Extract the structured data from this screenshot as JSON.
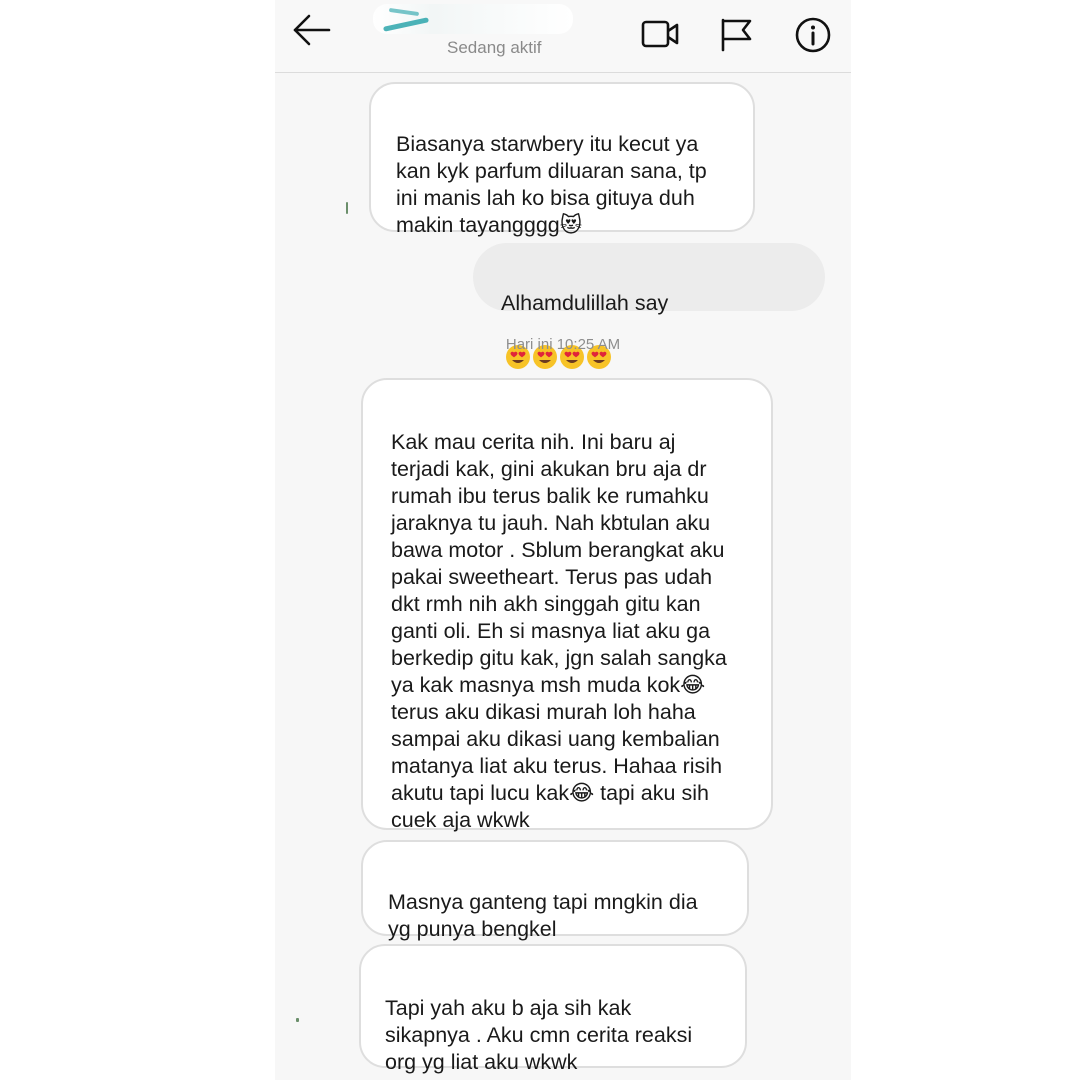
{
  "header": {
    "status": "Sedang aktif"
  },
  "messages": [
    {
      "side": "incoming",
      "text": "Biasanya starwbery itu kecut ya\nkan kyk parfum diluaran sana, tp\nini manis lah ko bisa gituya duh\nmakin tayangggg😻"
    },
    {
      "side": "outgoing",
      "text": "Alhamdulillah say",
      "emoji": "😍😍😍😍"
    },
    {
      "side": "incoming",
      "text": "Kak mau cerita nih. Ini baru aj\nterjadi kak, gini akukan bru aja dr\nrumah ibu terus balik ke rumahku\njaraknya tu jauh. Nah kbtulan aku\nbawa motor . Sblum berangkat aku\npakai sweetheart. Terus pas udah\ndkt rmh nih akh singgah gitu kan\nganti oli. Eh si masnya liat aku ga\nberkedip gitu kak, jgn salah sangka\nya kak masnya msh muda kok😂\nterus aku dikasi murah loh haha\nsampai aku dikasi uang kembalian\nmatanya liat aku terus. Hahaa risih\nakutu tapi lucu kak😂 tapi aku sih\ncuek aja wkwk"
    },
    {
      "side": "incoming",
      "text": "Masnya ganteng tapi mngkin dia\nyg punya bengkel"
    },
    {
      "side": "incoming",
      "text": "Tapi yah aku b aja sih kak\nsikapnya . Aku cmn cerita reaksi\norg yg liat aku wkwk"
    }
  ],
  "timestamp": "Hari ini 10:25 AM",
  "icons": {
    "back": "arrow-left-icon",
    "video": "video-camera-icon",
    "flag": "flag-icon",
    "info": "info-icon"
  },
  "colors": {
    "incoming_bubble": "#ffffff",
    "outgoing_bubble": "#ececec",
    "bubble_border": "#dedede",
    "accent": "#1fa0a6"
  }
}
